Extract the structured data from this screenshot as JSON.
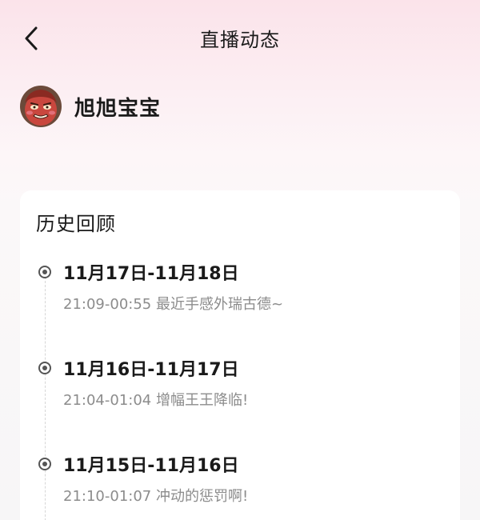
{
  "header": {
    "title": "直播动态",
    "back_icon": "chevron-left-icon"
  },
  "user": {
    "name": "旭旭宝宝",
    "avatar_icon": "avatar-icon"
  },
  "history": {
    "title": "历史回顾",
    "items": [
      {
        "date": "11月17日-11月18日",
        "desc": "21:09-00:55 最近手感外瑞古德~"
      },
      {
        "date": "11月16日-11月17日",
        "desc": "21:04-01:04 增幅王王降临!"
      },
      {
        "date": "11月15日-11月16日",
        "desc": "21:10-01:07 冲动的惩罚啊!"
      }
    ]
  },
  "colors": {
    "header_gradient_top": "#fbe3ea",
    "card_background": "#ffffff",
    "primary_text": "#1a1a1a",
    "secondary_text": "#8c8c8c",
    "timeline_dot": "#555555"
  }
}
